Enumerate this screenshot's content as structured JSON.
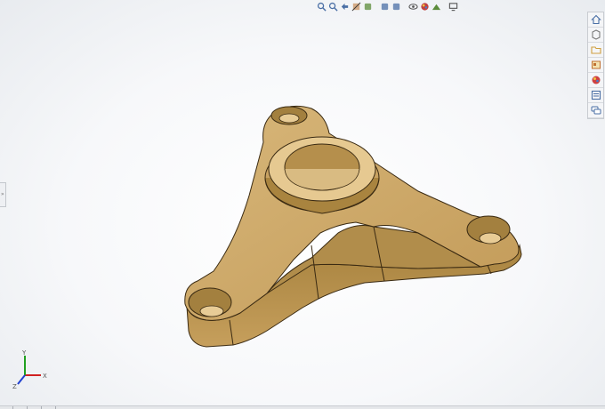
{
  "heads_up_toolbar": [
    {
      "name": "zoom-to-fit-icon",
      "color": "#4a6fa5"
    },
    {
      "name": "zoom-to-area-icon",
      "color": "#4a6fa5"
    },
    {
      "name": "previous-view-icon",
      "color": "#4a6fa5"
    },
    {
      "name": "section-view-icon",
      "color": "#c0783a"
    },
    {
      "name": "dynamic-annotation-icon",
      "color": "#5b8c3a"
    },
    {
      "name": "view-orientation-icon",
      "color": "#4a6fa5"
    },
    {
      "name": "display-style-icon",
      "color": "#4a6fa5"
    },
    {
      "name": "hide-show-items-icon",
      "color": "#555555"
    },
    {
      "name": "edit-appearance-icon",
      "color": "#c04040"
    },
    {
      "name": "apply-scene-icon",
      "color": "#5b8c3a"
    },
    {
      "name": "view-settings-icon",
      "color": "#555555"
    }
  ],
  "task_pane": [
    {
      "name": "solidworks-resources-icon",
      "color": "#4a6fa5"
    },
    {
      "name": "design-library-icon",
      "color": "#7a7a7a"
    },
    {
      "name": "file-explorer-icon",
      "color": "#d0a040"
    },
    {
      "name": "view-palette-icon",
      "color": "#c07030"
    },
    {
      "name": "appearances-scenes-icon",
      "color": "#d04040"
    },
    {
      "name": "custom-properties-icon",
      "color": "#4a6fa5"
    },
    {
      "name": "solidworks-forum-icon",
      "color": "#4a6fa5"
    }
  ],
  "triad": {
    "x_label": "X",
    "y_label": "Y",
    "z_label": "Z",
    "x_color": "#d02020",
    "y_color": "#20a020",
    "z_color": "#2040d0"
  },
  "part": {
    "body_color": "#c9a466",
    "shadow_color": "#8a6a36",
    "edge_color": "#3a2a12",
    "highlight_color": "#e3c58c"
  }
}
